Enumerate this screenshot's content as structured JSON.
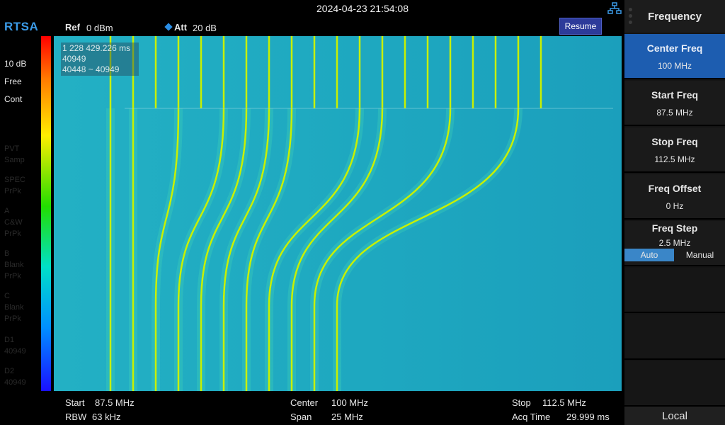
{
  "header": {
    "datetime": "2024-04-23 21:54:08",
    "brand": "RTSA",
    "ref_label": "Ref",
    "ref_value": "0 dBm",
    "att_label": "Att",
    "att_value": "20 dB",
    "resume_label": "Resume"
  },
  "left_panel": {
    "scale": "10 dB",
    "mode": "Free",
    "sweep": "Cont",
    "dim_items": [
      "PVT",
      "Samp",
      "SPEC",
      "PrPk",
      "A",
      "C&W",
      "PrPk",
      "B",
      "Blank",
      "PrPk",
      "C",
      "Blank",
      "PrPk",
      "D1",
      "40949",
      "D2",
      "40949"
    ]
  },
  "marker_info": {
    "time": "1 228 429.226 ms",
    "frame": "40949",
    "range": "40448 ~ 40949"
  },
  "footer": {
    "start_label": "Start",
    "start_value": "87.5 MHz",
    "rbw_label": "RBW",
    "rbw_value": "63 kHz",
    "center_label": "Center",
    "center_value": "100 MHz",
    "span_label": "Span",
    "span_value": "25 MHz",
    "stop_label": "Stop",
    "stop_value": "112.5 MHz",
    "acq_label": "Acq Time",
    "acq_value": "29.999 ms"
  },
  "softkeys": {
    "menu_title": "Frequency",
    "center_freq": {
      "label": "Center Freq",
      "value": "100 MHz"
    },
    "start_freq": {
      "label": "Start Freq",
      "value": "87.5 MHz"
    },
    "stop_freq": {
      "label": "Stop Freq",
      "value": "112.5 MHz"
    },
    "freq_offset": {
      "label": "Freq Offset",
      "value": "0 Hz"
    },
    "freq_step": {
      "label": "Freq Step",
      "value": "2.5 MHz",
      "auto": "Auto",
      "manual": "Manual"
    },
    "local": "Local"
  },
  "colors": {
    "accent": "#3b9be8",
    "active_key": "#1d5db0",
    "plot_bg": "#1eaac0",
    "trace": "#c8f000"
  }
}
